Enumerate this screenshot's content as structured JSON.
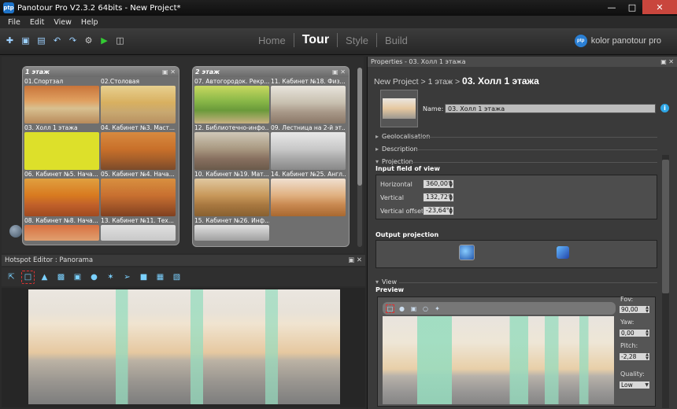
{
  "titlebar": {
    "title": "Panotour Pro V2.3.2 64bits - New Project*"
  },
  "menu": [
    "File",
    "Edit",
    "View",
    "Help"
  ],
  "modes": [
    "Home",
    "Tour",
    "Style",
    "Build"
  ],
  "active_mode": "Tour",
  "brand": "kolor panotour pro",
  "groups": [
    {
      "title": "1 этаж",
      "items": [
        {
          "label": "01.Спортзал"
        },
        {
          "label": "02.Столовая"
        },
        {
          "label": "03. Холл 1 этажа"
        },
        {
          "label": "04. Кабинет №3. Маст..."
        },
        {
          "label": "06. Кабинет №5. Нача..."
        },
        {
          "label": "05. Кабинет №4. Нача..."
        },
        {
          "label": "08. Кабинет №8. Нача..."
        },
        {
          "label": "13. Кабинет №11. Тех..."
        }
      ]
    },
    {
      "title": "2 этаж",
      "items": [
        {
          "label": "07. Автогородок. Рекр..."
        },
        {
          "label": "11. Кабинет №18. Физ..."
        },
        {
          "label": "12. Библиотечно-инфо..."
        },
        {
          "label": "09. Лестница на 2-й эт..."
        },
        {
          "label": "10. Кабинет №19. Мат..."
        },
        {
          "label": "14. Кабинет №25. Англ..."
        },
        {
          "label": "15. Кабинет №26. Инф..."
        }
      ]
    }
  ],
  "hotspot_editor": {
    "title": "Hotspot Editor : Panorama"
  },
  "properties": {
    "header": "Properties - 03. Холл 1 этажа",
    "crumb_project": "New Project",
    "crumb_sep": ">",
    "crumb_group": "1 этаж",
    "crumb_current": "03. Холл 1 этажа",
    "name_label": "Name:",
    "name_value": "03. Холл 1 этажа",
    "sections": {
      "geolocalisation": "Geolocalisation",
      "description": "Description",
      "projection": "Projection",
      "view": "View"
    },
    "fov": {
      "title": "Input field of view",
      "horizontal_label": "Horizontal",
      "horizontal": "360,00°",
      "vertical_label": "Vertical",
      "vertical": "132,72°",
      "offset_label": "Vertical offset",
      "offset": "-23,64°"
    },
    "output_projection": "Output projection",
    "preview": {
      "title": "Preview",
      "fov_label": "Fov:",
      "fov": "90,00",
      "yaw_label": "Yaw:",
      "yaw": "0,00",
      "pitch_label": "Pitch:",
      "pitch": "-2,28",
      "quality_label": "Quality:",
      "quality": "Low"
    }
  }
}
